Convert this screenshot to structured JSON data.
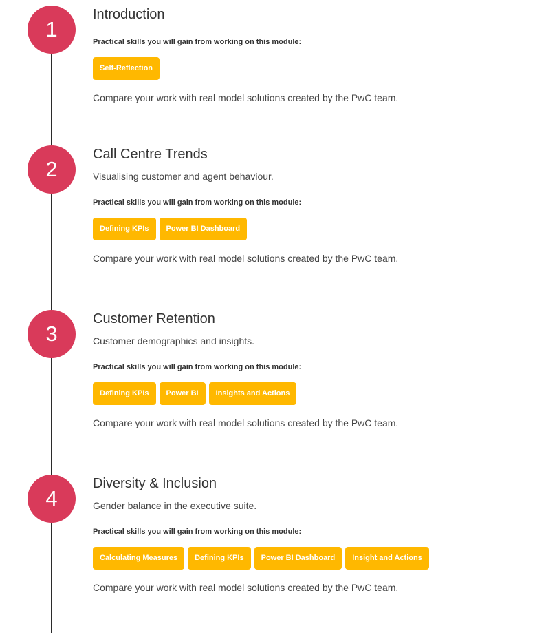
{
  "modules": [
    {
      "number": "1",
      "title": "Introduction",
      "subtitle": "",
      "skills_heading": "Practical skills you will gain from working on this module:",
      "skills": [
        "Self-Reflection"
      ],
      "compare_text": "Compare your work with real model solutions created by the PwC team."
    },
    {
      "number": "2",
      "title": "Call Centre Trends",
      "subtitle": "Visualising customer and agent behaviour.",
      "skills_heading": "Practical skills you will gain from working on this module:",
      "skills": [
        "Defining KPIs",
        "Power BI Dashboard"
      ],
      "compare_text": "Compare your work with real model solutions created by the PwC team."
    },
    {
      "number": "3",
      "title": "Customer Retention",
      "subtitle": "Customer demographics and insights.",
      "skills_heading": "Practical skills you will gain from working on this module:",
      "skills": [
        "Defining KPIs",
        "Power BI",
        "Insights and Actions"
      ],
      "compare_text": "Compare your work with real model solutions created by the PwC team."
    },
    {
      "number": "4",
      "title": "Diversity & Inclusion",
      "subtitle": "Gender balance in the executive suite.",
      "skills_heading": "Practical skills you will gain from working on this module:",
      "skills": [
        "Calculating Measures",
        "Defining KPIs",
        "Power BI Dashboard",
        "Insight and Actions"
      ],
      "compare_text": "Compare your work with real model solutions created by the PwC team."
    }
  ],
  "colors": {
    "step_circle": "#d93a5a",
    "skill_tag": "#ffb800",
    "timeline_line": "#2b2b2b"
  }
}
